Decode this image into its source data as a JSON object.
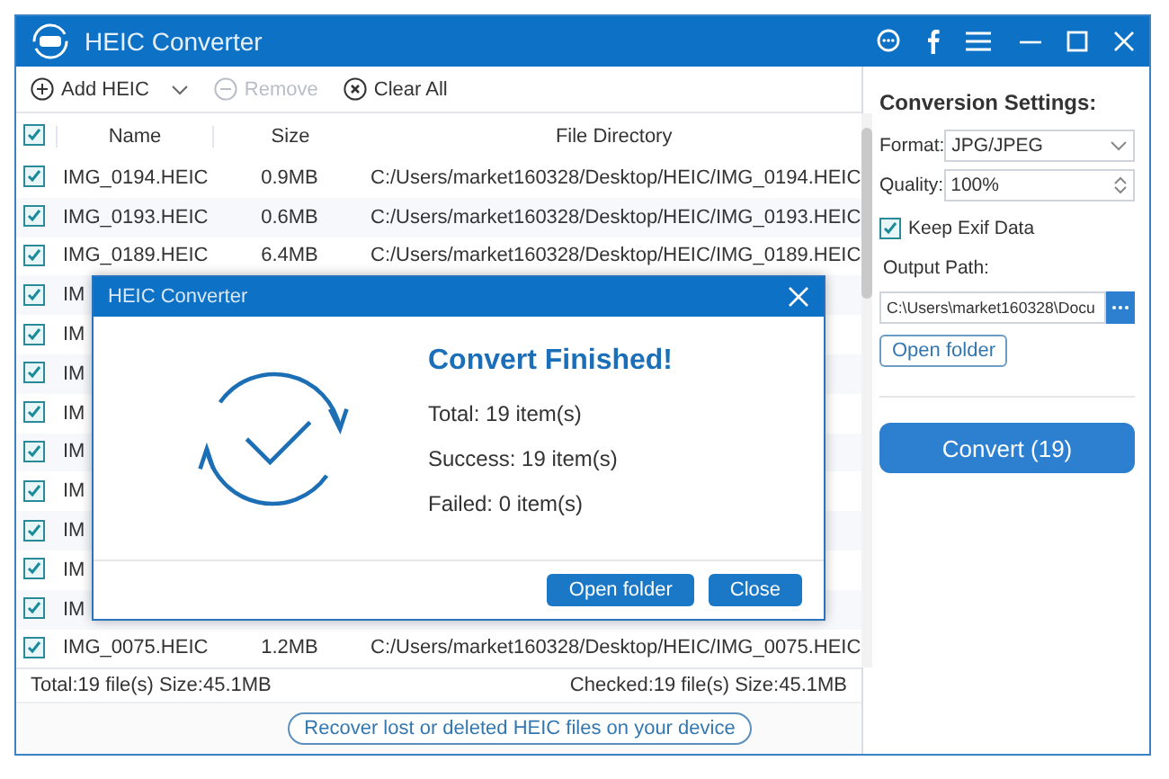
{
  "window": {
    "title": "HEIC Converter"
  },
  "toolbar": [
    {
      "kind": "add",
      "label": "Add HEIC",
      "disabled": false
    },
    {
      "kind": "remove",
      "label": "Remove",
      "disabled": true
    },
    {
      "kind": "clear",
      "label": "Clear All",
      "disabled": false
    }
  ],
  "table": {
    "all_checked": true,
    "columns": [
      "Name",
      "Size",
      "File Directory"
    ],
    "rows": [
      {
        "name": "IMG_0194.HEIC",
        "size": "0.9MB",
        "directory": "C:/Users/market160328/Desktop/HEIC/IMG_0194.HEIC",
        "checked": true
      },
      {
        "name": "IMG_0193.HEIC",
        "size": "0.6MB",
        "directory": "C:/Users/market160328/Desktop/HEIC/IMG_0193.HEIC",
        "checked": true
      },
      {
        "name": "IMG_0189.HEIC",
        "size": "6.4MB",
        "directory": "C:/Users/market160328/Desktop/HEIC/IMG_0189.HEIC",
        "checked": true
      },
      {
        "name": "IM",
        "checked": true
      },
      {
        "name": "IM",
        "checked": true
      },
      {
        "name": "IM",
        "checked": true
      },
      {
        "name": "IM",
        "checked": true
      },
      {
        "name": "IM",
        "checked": true
      },
      {
        "name": "IM",
        "checked": true
      },
      {
        "name": "IM",
        "checked": true
      },
      {
        "name": "IM",
        "checked": true
      },
      {
        "name": "IM",
        "checked": true
      },
      {
        "name": "IMG_0075.HEIC",
        "size": "1.2MB",
        "directory": "C:/Users/market160328/Desktop/HEIC/IMG_0075.HEIC",
        "checked": true
      }
    ]
  },
  "status_bar": {
    "total": "Total:19 file(s) Size:45.1MB",
    "checked": "Checked:19 file(s) Size:45.1MB"
  },
  "recover_link": "Recover lost or deleted HEIC files on your device",
  "settings": {
    "title": "Conversion Settings:",
    "format": {
      "label": "Format:",
      "value": "JPG/JPEG"
    },
    "quality": {
      "label": "Quality:",
      "value": "100%"
    },
    "keep_exif": {
      "label": "Keep Exif Data",
      "checked": true
    },
    "output_path": {
      "label": "Output Path:",
      "value": "C:\\Users\\market160328\\Docu"
    },
    "open_folder": "Open folder",
    "convert": "Convert (19)"
  },
  "dialog": {
    "title": "HEIC Converter",
    "heading": "Convert Finished!",
    "lines": [
      "Total: 19 item(s)",
      "Success: 19 item(s)",
      "Failed: 0 item(s)"
    ],
    "buttons": [
      "Open folder",
      "Close"
    ]
  }
}
